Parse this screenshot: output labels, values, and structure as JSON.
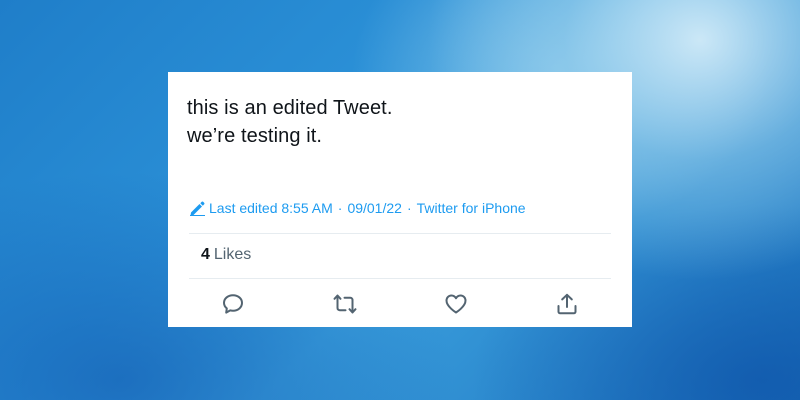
{
  "tweet": {
    "text_lines": [
      "this is an edited Tweet.",
      "we’re testing it."
    ],
    "edited_label": "Last edited 8:55 AM",
    "separator": "·",
    "date": "09/01/22",
    "source": "Twitter for iPhone",
    "likes_count": "4",
    "likes_label": "Likes"
  },
  "actions": [
    {
      "name": "reply",
      "icon": "speech-bubble-icon"
    },
    {
      "name": "retweet",
      "icon": "retweet-arrows-icon"
    },
    {
      "name": "like",
      "icon": "heart-icon"
    },
    {
      "name": "share",
      "icon": "share-upload-icon"
    }
  ],
  "colors": {
    "accent": "#1d9bf0",
    "text": "#0f1419",
    "secondary": "#536471",
    "icon": "#536471",
    "divider": "#e6ecf0"
  }
}
